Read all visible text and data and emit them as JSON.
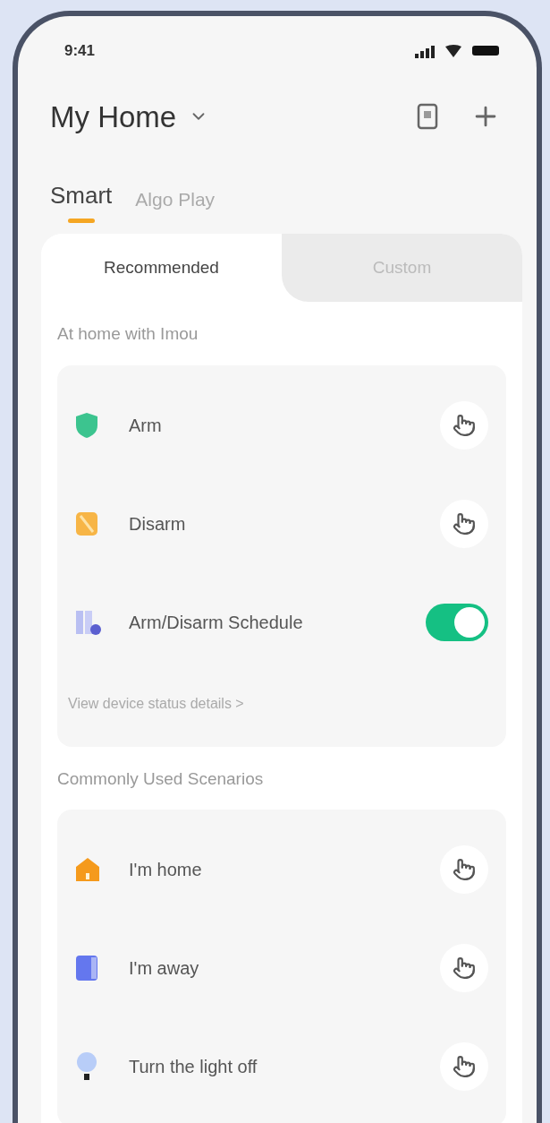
{
  "status_bar": {
    "time": "9:41"
  },
  "header": {
    "title": "My Home"
  },
  "tabs": [
    {
      "label": "Smart",
      "selected": true
    },
    {
      "label": "Algo Play",
      "selected": false
    }
  ],
  "subtabs": [
    {
      "label": "Recommended",
      "selected": true
    },
    {
      "label": "Custom",
      "selected": false
    }
  ],
  "sections": [
    {
      "title": "At home with Imou",
      "items": [
        {
          "label": "Arm",
          "kind": "tap"
        },
        {
          "label": "Disarm",
          "kind": "tap"
        },
        {
          "label": "Arm/Disarm Schedule",
          "kind": "toggle",
          "on": true
        }
      ],
      "link": "View device status details >"
    },
    {
      "title": "Commonly Used Scenarios",
      "items": [
        {
          "label": "I'm home",
          "kind": "tap"
        },
        {
          "label": "I'm away",
          "kind": "tap"
        },
        {
          "label": "Turn the light off",
          "kind": "tap"
        }
      ]
    }
  ]
}
